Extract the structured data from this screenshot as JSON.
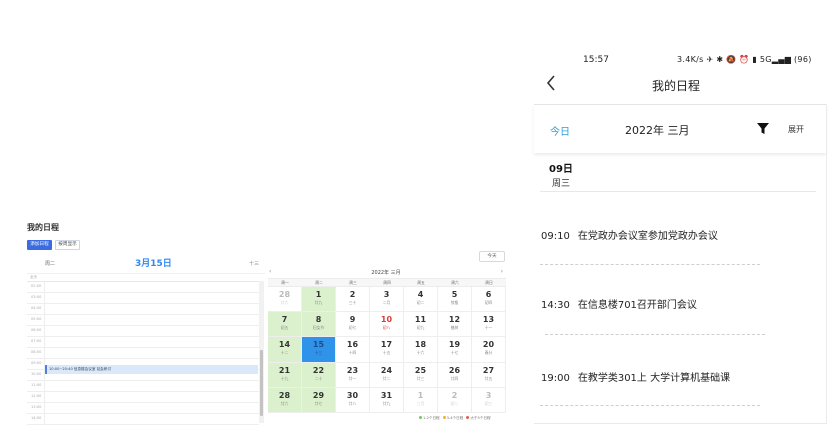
{
  "desktop": {
    "title": "我的日程",
    "btn_add": "添加日程",
    "btn_view": "按周显示",
    "day_view": {
      "weekday": "周二",
      "date": "3月15日",
      "lunar": "十三",
      "allday_label": "全天",
      "hours": [
        "02:00",
        "03:00",
        "04:00",
        "05:00",
        "06:00",
        "07:00",
        "08:00",
        "09:00",
        "10:00",
        "11:00",
        "12:00",
        "13:00",
        "14:00"
      ],
      "event": "10:00~20:40 信息楼会议室 站会研讨"
    },
    "today_btn": "今天",
    "month_cal": {
      "title": "2022年 三月",
      "prev": "‹",
      "next": "›",
      "weekdays": [
        "周一",
        "周二",
        "周三",
        "周四",
        "周五",
        "周六",
        "周日"
      ],
      "days": [
        {
          "n": "28",
          "s": "廿六"
        },
        {
          "n": "1",
          "s": "廿九"
        },
        {
          "n": "2",
          "s": "三十"
        },
        {
          "n": "3",
          "s": "二月"
        },
        {
          "n": "4",
          "s": "初二"
        },
        {
          "n": "5",
          "s": "惊蛰"
        },
        {
          "n": "6",
          "s": "初四"
        },
        {
          "n": "7",
          "s": "初五"
        },
        {
          "n": "8",
          "s": "妇女节"
        },
        {
          "n": "9",
          "s": "初七"
        },
        {
          "n": "10",
          "s": "初八"
        },
        {
          "n": "11",
          "s": "初九"
        },
        {
          "n": "12",
          "s": "植树"
        },
        {
          "n": "13",
          "s": "十一"
        },
        {
          "n": "14",
          "s": "十二"
        },
        {
          "n": "15",
          "s": "十三"
        },
        {
          "n": "16",
          "s": "十四"
        },
        {
          "n": "17",
          "s": "十五"
        },
        {
          "n": "18",
          "s": "十六"
        },
        {
          "n": "19",
          "s": "十七"
        },
        {
          "n": "20",
          "s": "春分"
        },
        {
          "n": "21",
          "s": "十九"
        },
        {
          "n": "22",
          "s": "二十"
        },
        {
          "n": "23",
          "s": "廿一"
        },
        {
          "n": "24",
          "s": "廿二"
        },
        {
          "n": "25",
          "s": "廿三"
        },
        {
          "n": "26",
          "s": "廿四"
        },
        {
          "n": "27",
          "s": "廿五"
        },
        {
          "n": "28",
          "s": "廿六"
        },
        {
          "n": "29",
          "s": "廿七"
        },
        {
          "n": "30",
          "s": "廿八"
        },
        {
          "n": "31",
          "s": "廿九"
        },
        {
          "n": "1",
          "s": "三月"
        },
        {
          "n": "2",
          "s": "初二"
        },
        {
          "n": "3",
          "s": "初三"
        }
      ],
      "legend": [
        {
          "label": "1-2个日程",
          "color": "#7cc26a"
        },
        {
          "label": "3-4个日程",
          "color": "#f2b134"
        },
        {
          "label": "大于5个日程",
          "color": "#e55b4b"
        }
      ]
    }
  },
  "phone": {
    "time": "15:57",
    "status_right": "3.4K/s ✈ ✱ 🔕 ⏰ ▮ 5G▂▄▆ (96)",
    "title": "我的日程",
    "today": "今日",
    "year_month": "2022年  三月",
    "expand": "展开",
    "day_num": "09日",
    "weekday": "周三",
    "events": [
      {
        "time": "09:10",
        "text": "在党政办会议室参加党政办会议"
      },
      {
        "time": "14:30",
        "text": "在信息楼701召开部门会议"
      },
      {
        "time": "19:00",
        "text": "在教学类301上 大学计算机基础课"
      }
    ]
  }
}
